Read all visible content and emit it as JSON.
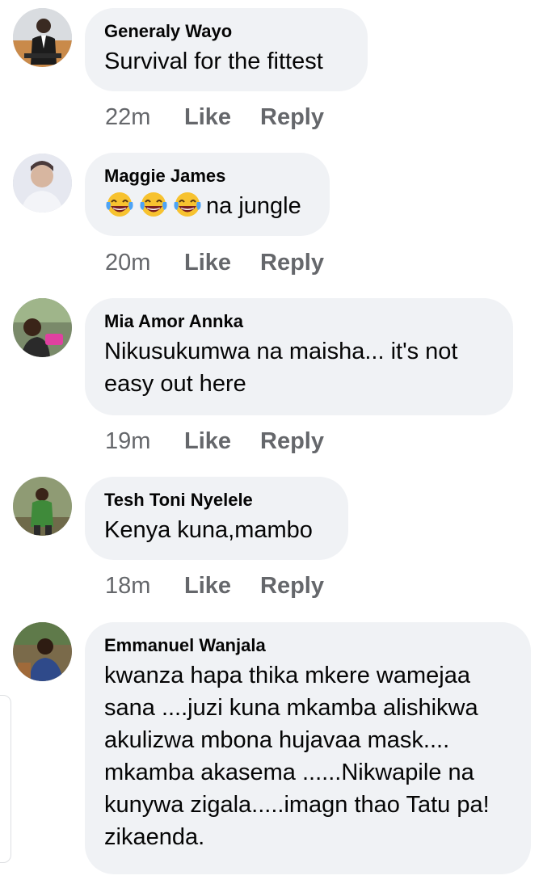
{
  "comments": [
    {
      "author": "Generaly Wayo",
      "text": "Survival for the fittest",
      "time": "22m",
      "like_label": "Like",
      "reply_label": "Reply",
      "avatar_icon": "avatar-man-suit-icon"
    },
    {
      "author": "Maggie James",
      "emoji_icon": "laughing-crying-emoji-icon",
      "emoji_count": 3,
      "text": "na jungle",
      "time": "20m",
      "like_label": "Like",
      "reply_label": "Reply",
      "avatar_icon": "avatar-person-light-icon"
    },
    {
      "author": "Mia Amor Annka",
      "text": "Nikusukumwa na maisha... it's not easy out here",
      "time": "19m",
      "like_label": "Like",
      "reply_label": "Reply",
      "avatar_icon": "avatar-person-outdoor-icon"
    },
    {
      "author": "Tesh Toni Nyelele",
      "text": "Kenya kuna,mambo",
      "time": "18m",
      "like_label": "Like",
      "reply_label": "Reply",
      "avatar_icon": "avatar-person-green-icon"
    },
    {
      "author": "Emmanuel Wanjala",
      "text": "kwanza hapa thika mkere wamejaa sana ....juzi kuna mkamba alishikwa akulizwa mbona hujavaa mask.... mkamba akasema ......Nikwapile na kunywa zigala.....imagn thao Tatu pa! zikaenda.",
      "avatar_icon": "avatar-person-blue-icon"
    }
  ],
  "colors": {
    "bubble_bg": "#f0f2f5",
    "meta_text": "#65676b",
    "primary_text": "#050505"
  }
}
